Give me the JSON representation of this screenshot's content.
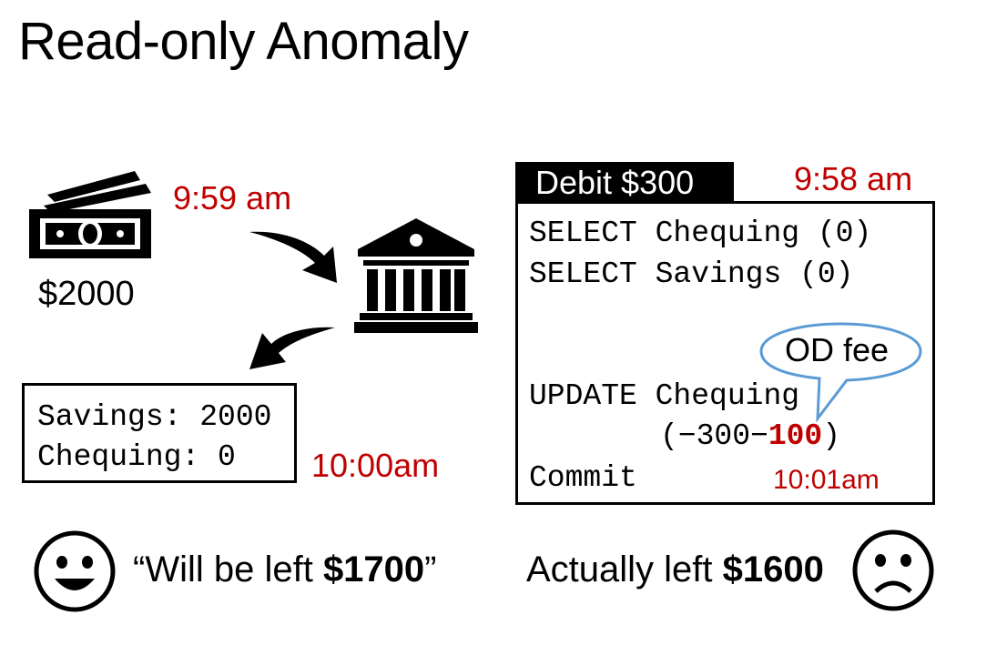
{
  "title": "Read-only Anomaly",
  "money": {
    "amount": "$2000",
    "time": "9:59 am"
  },
  "report": {
    "line1": "Savings: 2000",
    "line2": "Chequing: 0",
    "time": "10:00am"
  },
  "transaction": {
    "header": "Debit $300",
    "time": "9:58 am",
    "lines": [
      "SELECT Chequing (0)",
      "SELECT Savings (0)"
    ],
    "update": "UPDATE Chequing",
    "update_expr_prefix": "(−300−",
    "update_expr_fee": "100",
    "update_expr_suffix": ")",
    "commit": "Commit",
    "commit_time": "10:01am",
    "bubble": "OD fee"
  },
  "expectation": {
    "prefix": "“Will be left ",
    "amount": "$1700",
    "suffix": "”"
  },
  "reality": {
    "prefix": "Actually left ",
    "amount": "$1600"
  },
  "colors": {
    "accent_red": "#c00000",
    "bubble_border": "#5b9bd5"
  }
}
